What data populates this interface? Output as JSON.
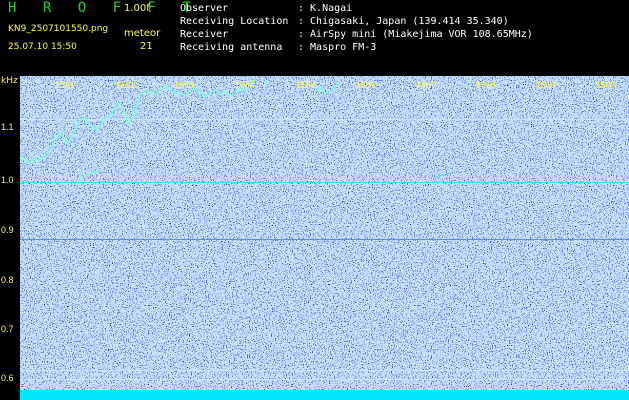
{
  "header": {
    "app_title": "H R O F F T",
    "version": "1.00f",
    "filename": "KN9_2507101550.png",
    "timestamp": "25.07.10 15:50",
    "meteor_label": "meteor",
    "meteor_count": "21"
  },
  "info": [
    {
      "key": "Observer",
      "value": ": K.Nagai"
    },
    {
      "key": "Receiving Location",
      "value": ": Chigasaki, Japan (139.414 35.340)"
    },
    {
      "key": "Receiver",
      "value": ": AirSpy mini (Miakejima VOR 108.65MHz)"
    },
    {
      "key": "Receiving antenna",
      "value": ": Maspro FM-3"
    }
  ],
  "axis": {
    "unit_label": "kHz",
    "y_ticks": [
      "1.1",
      "1.0",
      "0.9",
      "0.8",
      "0.7",
      "0.6"
    ],
    "time_ticks": [
      "1551",
      "1552",
      "1553",
      "1554",
      "1555",
      "1556",
      "1557",
      "1558",
      "1559",
      "1600"
    ]
  },
  "colors": {
    "background": "#0c1896",
    "label": "#ffff33",
    "trace": "#7fffcf",
    "title": "#1fd31f"
  }
}
